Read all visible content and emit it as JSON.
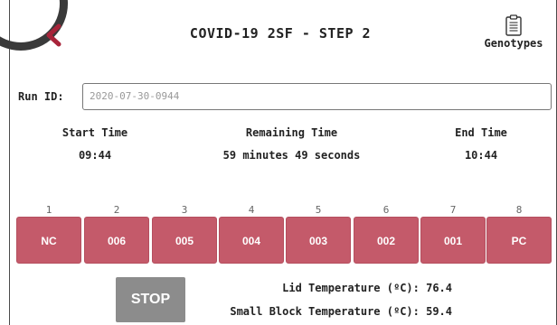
{
  "header": {
    "title": "COVID-19 2SF - STEP 2",
    "genotypes_label": "Genotypes"
  },
  "run": {
    "label": "Run ID:",
    "value": "2020-07-30-0944"
  },
  "timing": {
    "start_label": "Start Time",
    "start_value": "09:44",
    "remaining_label": "Remaining Time",
    "remaining_value": "59 minutes 49 seconds",
    "end_label": "End Time",
    "end_value": "10:44"
  },
  "wells": [
    {
      "number": "1",
      "label": "NC"
    },
    {
      "number": "2",
      "label": "006"
    },
    {
      "number": "3",
      "label": "005"
    },
    {
      "number": "4",
      "label": "004"
    },
    {
      "number": "5",
      "label": "003"
    },
    {
      "number": "6",
      "label": "002"
    },
    {
      "number": "7",
      "label": "001"
    },
    {
      "number": "8",
      "label": "PC"
    }
  ],
  "controls": {
    "stop_label": "STOP"
  },
  "temperatures": {
    "lid": "Lid Temperature (ºC): 76.4",
    "small_block": "Small Block Temperature (ºC): 59.4"
  },
  "colors": {
    "well_fill": "#c45a6a",
    "back_arrow": "#a8243a",
    "stop_fill": "#8c8c8c"
  }
}
